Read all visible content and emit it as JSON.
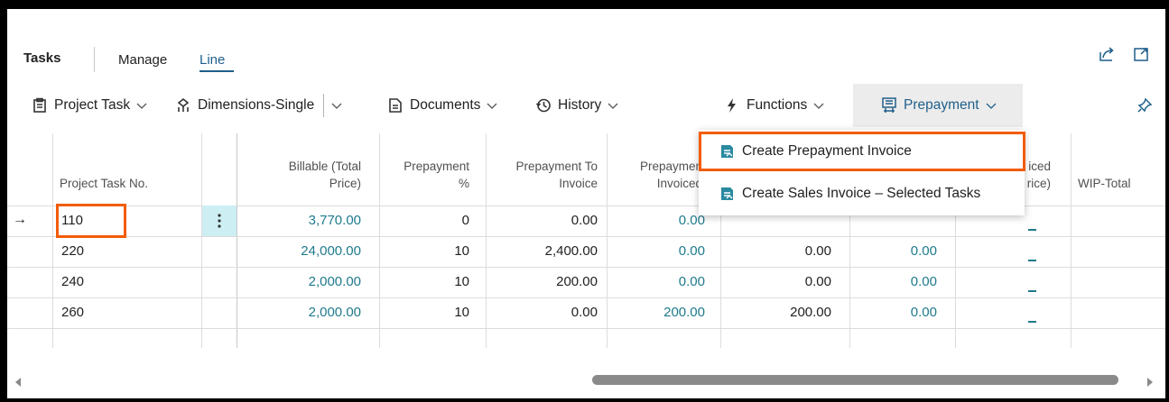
{
  "tabs": {
    "tasks": "Tasks",
    "manage": "Manage",
    "line": "Line"
  },
  "actions": {
    "project_task": "Project Task",
    "dimensions_single": "Dimensions-Single",
    "documents": "Documents",
    "history": "History",
    "functions": "Functions",
    "prepayment": "Prepayment"
  },
  "menu": {
    "create_prepayment_invoice": "Create Prepayment Invoice",
    "create_sales_invoice_selected": "Create Sales Invoice – Selected Tasks"
  },
  "columns": {
    "project_task_no": "Project Task No.",
    "billable_1": "Billable (Total",
    "billable_2": "Price)",
    "prepayment_pct_1": "Prepayment",
    "prepayment_pct_2": "%",
    "prepayment_to_invoice_1": "Prepayment To",
    "prepayment_to_invoice_2": "Invoice",
    "prepayment_invoiced_1": "Prepaymen",
    "prepayment_invoiced_2": "Invoiced",
    "invoiced_1": "iced",
    "invoiced_2": "rice)",
    "wip_total": "WIP-Total"
  },
  "rows": [
    {
      "no": "110",
      "billable": "3,770.00",
      "pct": "0",
      "to_invoice": "0.00",
      "invoiced": "0.00",
      "c6": "",
      "c7": "",
      "c8": "_"
    },
    {
      "no": "220",
      "billable": "24,000.00",
      "pct": "10",
      "to_invoice": "2,400.00",
      "invoiced": "0.00",
      "c6": "0.00",
      "c7": "0.00",
      "c8": "_"
    },
    {
      "no": "240",
      "billable": "2,000.00",
      "pct": "10",
      "to_invoice": "200.00",
      "invoiced": "0.00",
      "c6": "0.00",
      "c7": "0.00",
      "c8": "_"
    },
    {
      "no": "260",
      "billable": "2,000.00",
      "pct": "10",
      "to_invoice": "0.00",
      "invoiced": "200.00",
      "c6": "200.00",
      "c7": "0.00",
      "c8": "_"
    }
  ],
  "colors": {
    "accent": "#1f5f8b",
    "link": "#1f7a8c",
    "highlight": "#f25c05",
    "selected_cell": "#cdeef3"
  },
  "icons": {
    "share": "share-icon",
    "expand": "expand-icon",
    "pin": "pin-icon",
    "row_arrow": "→",
    "kebab": "⋮"
  }
}
